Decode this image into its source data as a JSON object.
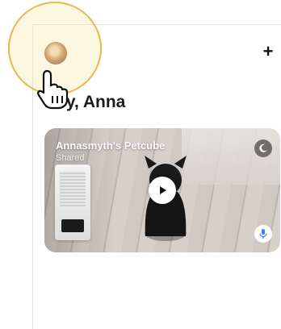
{
  "header": {
    "add_icon": "plus-icon",
    "avatar_icon": "user-avatar"
  },
  "greeting": {
    "text": "Hey, Anna"
  },
  "camera_card": {
    "title": "Annasmyth's Petcube",
    "subtitle": "Shared",
    "night_mode_icon": "moon-icon",
    "play_icon": "play-icon",
    "mic_icon": "microphone-icon"
  },
  "overlay": {
    "cursor_icon": "hand-pointer-icon",
    "highlight_color": "#e8b84a"
  }
}
